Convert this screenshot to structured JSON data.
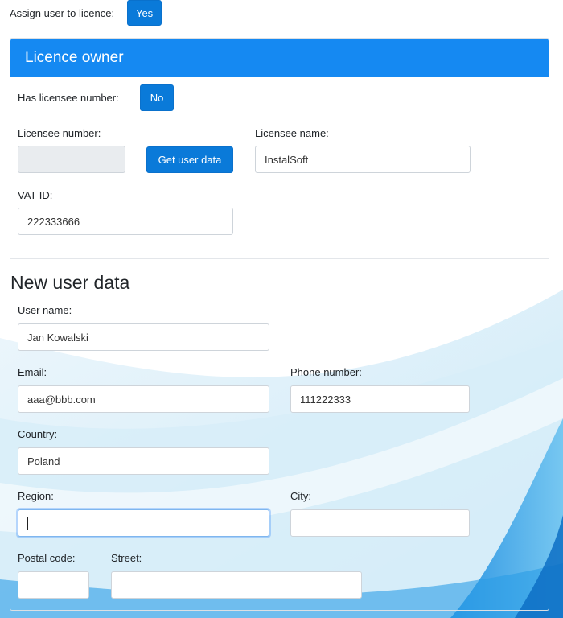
{
  "assign": {
    "label": "Assign user to licence:",
    "button": "Yes"
  },
  "owner": {
    "title": "Licence owner",
    "has_number_label": "Has licensee number:",
    "has_number_button": "No",
    "number_label": "Licensee number:",
    "number_value": "",
    "get_data_button": "Get user data",
    "name_label": "Licensee name:",
    "name_value": "InstalSoft",
    "vat_label": "VAT ID:",
    "vat_value": "222333666"
  },
  "user": {
    "title": "New user data",
    "username_label": "User name:",
    "username_value": "Jan Kowalski",
    "email_label": "Email:",
    "email_value": "aaa@bbb.com",
    "phone_label": "Phone number:",
    "phone_value": "111222333",
    "country_label": "Country:",
    "country_value": "Poland",
    "region_label": "Region:",
    "region_value": "",
    "city_label": "City:",
    "city_value": "",
    "postal_label": "Postal code:",
    "postal_value": "",
    "street_label": "Street:",
    "street_value": ""
  },
  "colors": {
    "primary": "#0a7ad9",
    "header": "#1589f2",
    "disabled": "#e9ecef"
  }
}
